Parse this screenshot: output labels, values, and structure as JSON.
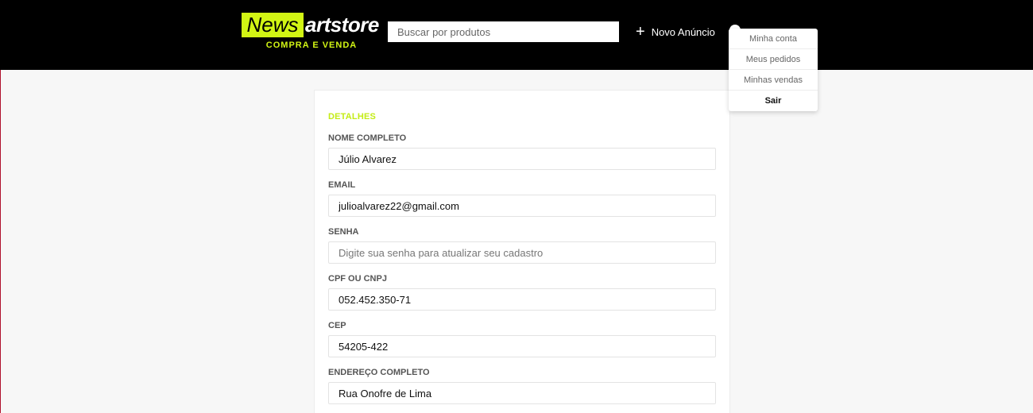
{
  "header": {
    "logo": {
      "part1": "News",
      "part2": "artstore",
      "tagline": "COMPRA E VENDA"
    },
    "search": {
      "placeholder": "Buscar por produtos",
      "value": ""
    },
    "new_ad_label": "Novo Anúncio",
    "account": {
      "icon": "user-circle-icon",
      "menu": [
        "Minha conta",
        "Meus pedidos",
        "Minhas vendas",
        "Sair"
      ]
    }
  },
  "form": {
    "section_title": "DETALHES",
    "fields": [
      {
        "label": "NOME COMPLETO",
        "value": "Júlio Alvarez",
        "placeholder": ""
      },
      {
        "label": "EMAIL",
        "value": "julioalvarez22@gmail.com",
        "placeholder": ""
      },
      {
        "label": "SENHA",
        "value": "",
        "placeholder": "Digite sua senha para atualizar seu cadastro"
      },
      {
        "label": "CPF OU CNPJ",
        "value": "052.452.350-71",
        "placeholder": ""
      },
      {
        "label": "CEP",
        "value": "54205-422",
        "placeholder": ""
      },
      {
        "label": "ENDEREÇO COMPLETO",
        "value": "Rua Onofre de Lima",
        "placeholder": ""
      }
    ]
  },
  "colors": {
    "accent": "#d2f514",
    "header_bg": "#000000",
    "page_bg": "#f7f7f7"
  }
}
